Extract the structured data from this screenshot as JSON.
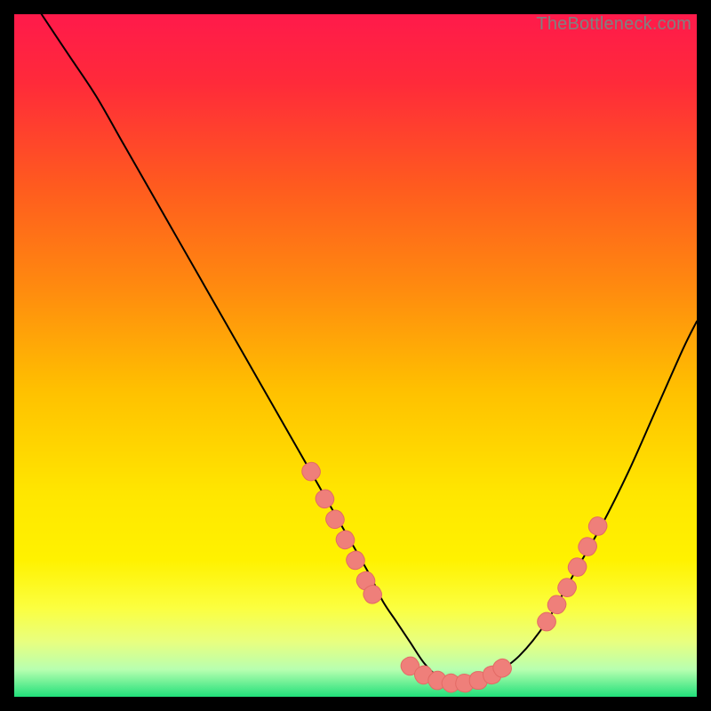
{
  "watermark": "TheBottleneck.com",
  "colors": {
    "gradient_stops": [
      {
        "offset": 0.0,
        "color": "#ff1a4b"
      },
      {
        "offset": 0.1,
        "color": "#ff2a3a"
      },
      {
        "offset": 0.25,
        "color": "#ff5a1f"
      },
      {
        "offset": 0.4,
        "color": "#ff8a0f"
      },
      {
        "offset": 0.55,
        "color": "#ffc000"
      },
      {
        "offset": 0.7,
        "color": "#ffe600"
      },
      {
        "offset": 0.8,
        "color": "#fff200"
      },
      {
        "offset": 0.87,
        "color": "#fbff40"
      },
      {
        "offset": 0.92,
        "color": "#e8ff80"
      },
      {
        "offset": 0.96,
        "color": "#b8ffb0"
      },
      {
        "offset": 1.0,
        "color": "#21e07a"
      }
    ],
    "curve": "#000000",
    "marker_fill": "#ef7f7a",
    "marker_stroke": "#e36a65"
  },
  "chart_data": {
    "type": "line",
    "title": "",
    "xlabel": "",
    "ylabel": "",
    "xlim": [
      0,
      100
    ],
    "ylim": [
      0,
      100
    ],
    "grid": false,
    "legend": false,
    "series": [
      {
        "name": "bottleneck-curve",
        "x": [
          4,
          8,
          12,
          16,
          20,
          24,
          28,
          32,
          36,
          40,
          44,
          48,
          52,
          54,
          56,
          58,
          60,
          62,
          64,
          66,
          68,
          70,
          74,
          78,
          82,
          86,
          90,
          94,
          98,
          100
        ],
        "y": [
          100,
          94,
          88,
          81,
          74,
          67,
          60,
          53,
          46,
          39,
          32,
          25,
          18,
          14,
          11,
          8,
          5,
          3,
          2,
          2,
          2,
          3,
          6,
          11,
          18,
          25,
          33,
          42,
          51,
          55
        ]
      }
    ],
    "markers": [
      {
        "name": "left-cluster",
        "x": [
          43.5,
          45.5,
          47,
          48.5,
          50,
          51.5,
          52.5
        ],
        "y": [
          33,
          29,
          26,
          23,
          20,
          17,
          15
        ]
      },
      {
        "name": "floor-cluster",
        "x": [
          58,
          60,
          62,
          64,
          66,
          68,
          70,
          71.5
        ],
        "y": [
          4.5,
          3.2,
          2.4,
          2.0,
          2.0,
          2.4,
          3.2,
          4.2
        ]
      },
      {
        "name": "right-cluster",
        "x": [
          78,
          79.5,
          81,
          82.5,
          84,
          85.5
        ],
        "y": [
          11,
          13.5,
          16,
          19,
          22,
          25
        ]
      }
    ],
    "marker_style": {
      "shape": "rounded-rect",
      "width": 2.6,
      "height": 2.6,
      "rotate_to_slope": true
    }
  }
}
